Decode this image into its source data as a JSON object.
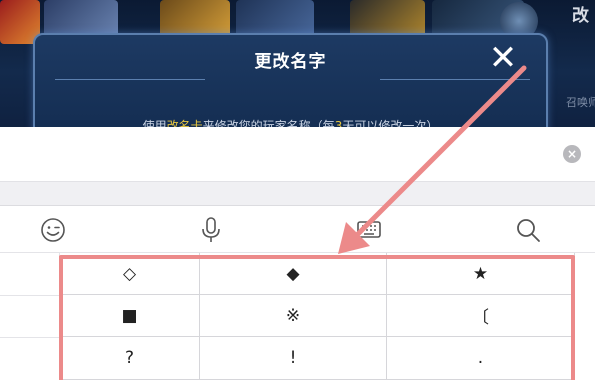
{
  "dialog": {
    "title": "更改名字",
    "close_glyph": "✕",
    "desc_before": "使用",
    "desc_card": "改名卡",
    "desc_middle": "来修改您的玩家名称（每",
    "desc_days": "3",
    "desc_after": "天可以修改一次）"
  },
  "game_side": {
    "title": "改",
    "small": "召唤师"
  },
  "search": {
    "value": "",
    "placeholder": ""
  },
  "toolbar": {
    "icons": [
      "emoji-icon",
      "microphone-icon",
      "keyboard-icon",
      "search-icon"
    ]
  },
  "symbols": {
    "rows": [
      [
        "◇",
        "◆",
        "★"
      ],
      [
        "■",
        "※",
        "〔"
      ],
      [
        "?",
        "!",
        "."
      ]
    ]
  },
  "colors": {
    "annotation": "#ec8a8a",
    "dialog_bg": "#1d3a63",
    "highlight_text": "#e6c640"
  }
}
